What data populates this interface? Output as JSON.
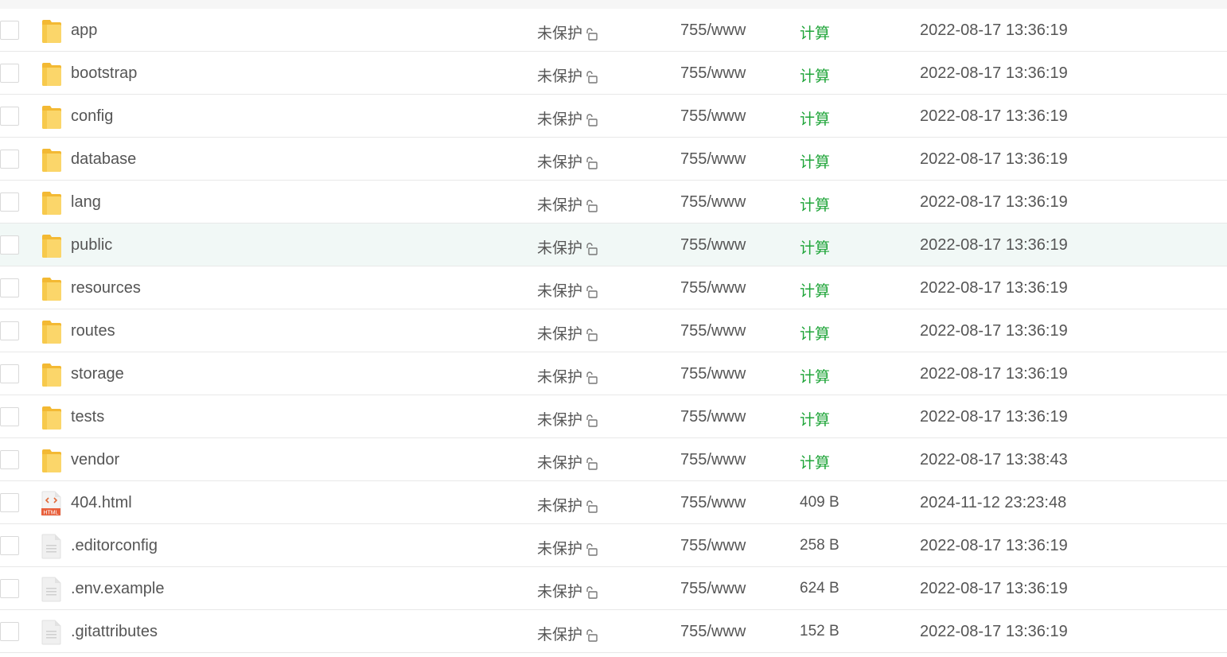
{
  "colors": {
    "accent_green": "#20a53a",
    "row_highlight": "#f1f8f6",
    "folder_yellow": "#f7c94b"
  },
  "files": [
    {
      "name": "app",
      "type": "folder",
      "protection": "未保护",
      "permission": "755/www",
      "size": "计算",
      "mtime": "2022-08-17 13:36:19"
    },
    {
      "name": "bootstrap",
      "type": "folder",
      "protection": "未保护",
      "permission": "755/www",
      "size": "计算",
      "mtime": "2022-08-17 13:36:19"
    },
    {
      "name": "config",
      "type": "folder",
      "protection": "未保护",
      "permission": "755/www",
      "size": "计算",
      "mtime": "2022-08-17 13:36:19"
    },
    {
      "name": "database",
      "type": "folder",
      "protection": "未保护",
      "permission": "755/www",
      "size": "计算",
      "mtime": "2022-08-17 13:36:19"
    },
    {
      "name": "lang",
      "type": "folder",
      "protection": "未保护",
      "permission": "755/www",
      "size": "计算",
      "mtime": "2022-08-17 13:36:19"
    },
    {
      "name": "public",
      "type": "folder",
      "protection": "未保护",
      "permission": "755/www",
      "size": "计算",
      "mtime": "2022-08-17 13:36:19",
      "highlighted": true
    },
    {
      "name": "resources",
      "type": "folder",
      "protection": "未保护",
      "permission": "755/www",
      "size": "计算",
      "mtime": "2022-08-17 13:36:19"
    },
    {
      "name": "routes",
      "type": "folder",
      "protection": "未保护",
      "permission": "755/www",
      "size": "计算",
      "mtime": "2022-08-17 13:36:19"
    },
    {
      "name": "storage",
      "type": "folder",
      "protection": "未保护",
      "permission": "755/www",
      "size": "计算",
      "mtime": "2022-08-17 13:36:19"
    },
    {
      "name": "tests",
      "type": "folder",
      "protection": "未保护",
      "permission": "755/www",
      "size": "计算",
      "mtime": "2022-08-17 13:36:19"
    },
    {
      "name": "vendor",
      "type": "folder",
      "protection": "未保护",
      "permission": "755/www",
      "size": "计算",
      "mtime": "2022-08-17 13:38:43"
    },
    {
      "name": "404.html",
      "type": "html",
      "icon_label": "HTML",
      "protection": "未保护",
      "permission": "755/www",
      "size": "409 B",
      "mtime": "2024-11-12 23:23:48"
    },
    {
      "name": ".editorconfig",
      "type": "file",
      "protection": "未保护",
      "permission": "755/www",
      "size": "258 B",
      "mtime": "2022-08-17 13:36:19"
    },
    {
      "name": ".env.example",
      "type": "file",
      "protection": "未保护",
      "permission": "755/www",
      "size": "624 B",
      "mtime": "2022-08-17 13:36:19"
    },
    {
      "name": ".gitattributes",
      "type": "file",
      "protection": "未保护",
      "permission": "755/www",
      "size": "152 B",
      "mtime": "2022-08-17 13:36:19"
    }
  ]
}
